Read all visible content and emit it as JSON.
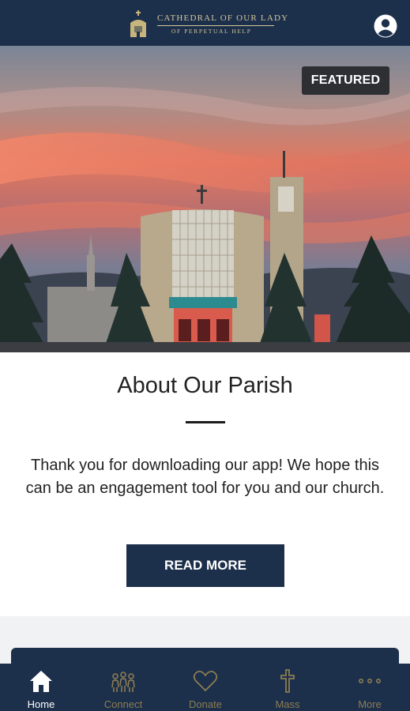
{
  "header": {
    "logo_line1": "CATHEDRAL OF OUR LADY",
    "logo_line2": "OF PERPETUAL HELP",
    "profile_icon": "user-circle-icon"
  },
  "hero": {
    "badge": "FEATURED",
    "image": "cathedral-at-sunset-photo"
  },
  "article": {
    "title": "About Our Parish",
    "body": "Thank you for downloading our app! We hope this can be an engagement tool for you and our church.",
    "button": "READ MORE"
  },
  "tabs": [
    {
      "label": "Home",
      "icon": "home-icon",
      "active": true
    },
    {
      "label": "Connect",
      "icon": "people-icon",
      "active": false
    },
    {
      "label": "Donate",
      "icon": "heart-icon",
      "active": false
    },
    {
      "label": "Mass",
      "icon": "cross-icon",
      "active": false
    },
    {
      "label": "More",
      "icon": "more-dots-icon",
      "active": false
    }
  ],
  "colors": {
    "navy": "#1c2f4b",
    "gold": "#8d7d52",
    "logo_gold": "#d6c79b"
  }
}
